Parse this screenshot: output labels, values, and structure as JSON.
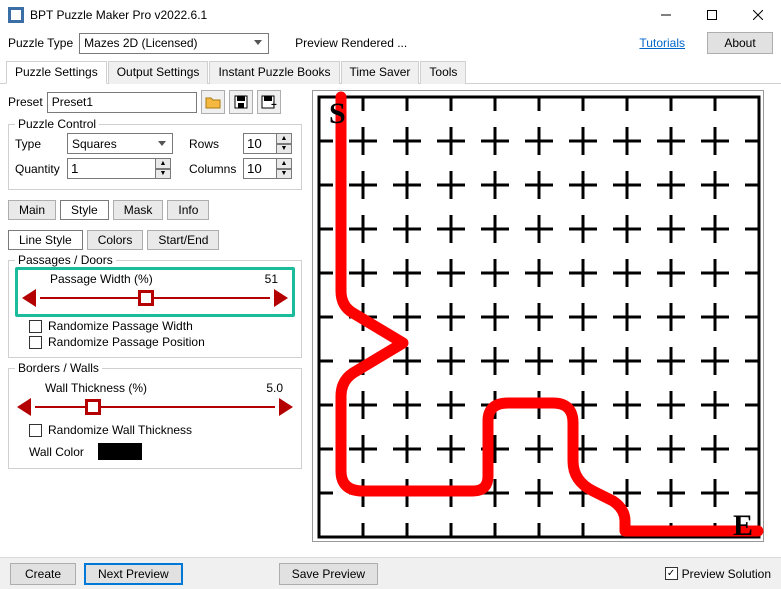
{
  "window": {
    "title": "BPT Puzzle Maker Pro v2022.6.1"
  },
  "top": {
    "puzzle_type_label": "Puzzle Type",
    "puzzle_type_value": "Mazes 2D (Licensed)",
    "preview_status": "Preview Rendered ...",
    "tutorials": "Tutorials",
    "about": "About"
  },
  "main_tabs": {
    "items": [
      "Puzzle Settings",
      "Output Settings",
      "Instant Puzzle Books",
      "Time Saver",
      "Tools"
    ],
    "active": 0
  },
  "preset": {
    "label": "Preset",
    "value": "Preset1"
  },
  "puzzle_control": {
    "group_label": "Puzzle Control",
    "type_label": "Type",
    "type_value": "Squares",
    "rows_label": "Rows",
    "rows_value": "10",
    "cols_label": "Columns",
    "cols_value": "10",
    "qty_label": "Quantity",
    "qty_value": "1"
  },
  "subtabs": {
    "items": [
      "Main",
      "Style",
      "Mask",
      "Info"
    ],
    "active": 1
  },
  "style_tabs": {
    "items": [
      "Line Style",
      "Colors",
      "Start/End"
    ],
    "active": 0
  },
  "passages": {
    "group_label": "Passages / Doors",
    "width_label": "Passage Width (%)",
    "width_value": "51",
    "randomize_width": "Randomize Passage Width",
    "randomize_position": "Randomize Passage Position"
  },
  "borders": {
    "group_label": "Borders / Walls",
    "thickness_label": "Wall Thickness (%)",
    "thickness_value": "5.0",
    "randomize_thickness": "Randomize Wall Thickness",
    "wall_color_label": "Wall Color",
    "wall_color": "#000000"
  },
  "bottom": {
    "create": "Create",
    "next_preview": "Next Preview",
    "save_preview": "Save Preview",
    "preview_solution": "Preview Solution",
    "preview_solution_checked": true
  },
  "maze": {
    "start_label": "S",
    "end_label": "E"
  }
}
